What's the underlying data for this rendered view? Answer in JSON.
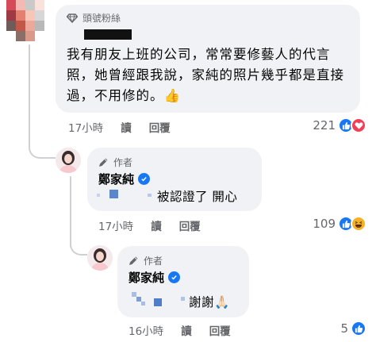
{
  "comment": {
    "badge_label": "頭號粉絲",
    "text": "我有朋友上班的公司，常常要修藝人的代言照，她曾經跟我說，家純的照片幾乎都是直接過，不用修的。👍",
    "time": "17小時",
    "read_label": "讀",
    "reply_label": "回覆",
    "reaction_count": "221",
    "reactions": [
      "like-icon",
      "love-icon"
    ]
  },
  "reply1": {
    "badge_label": "作者",
    "author": "鄭家純",
    "text": "被認證了 開心",
    "time": "17小時",
    "read_label": "讀",
    "reply_label": "回覆",
    "reaction_count": "109",
    "reactions": [
      "like-icon",
      "haha-icon"
    ]
  },
  "reply2": {
    "badge_label": "作者",
    "author": "鄭家純",
    "text": "謝謝🙏🏻",
    "time": "16小時",
    "read_label": "讀",
    "reply_label": "回覆",
    "reaction_count": "5",
    "reactions": [
      "like-icon"
    ]
  },
  "colors": {
    "bubble": "#f0f2f5",
    "meta_text": "#65676b",
    "like": "#1877f2",
    "love": "#f33e58",
    "haha": "#f7b125",
    "thread_line": "#ced0d4"
  }
}
